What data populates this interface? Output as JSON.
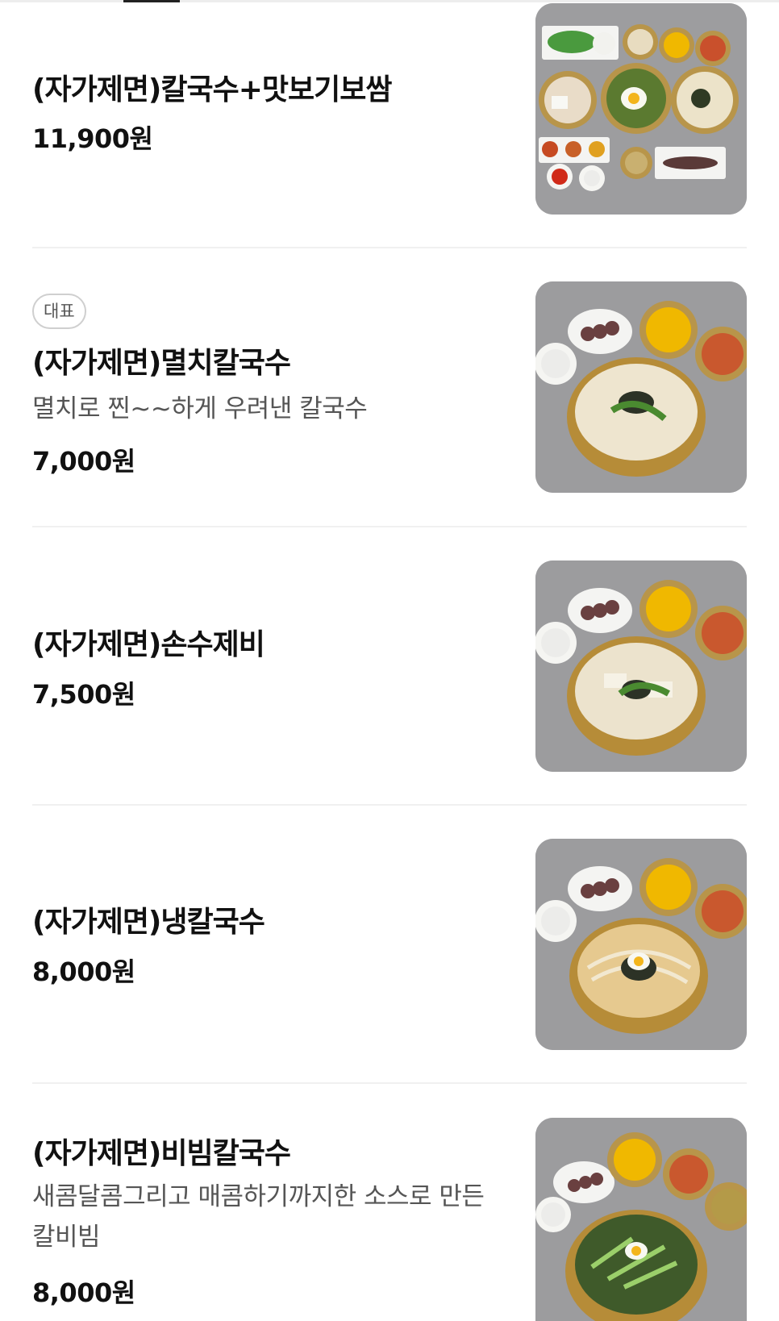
{
  "menu": {
    "items": [
      {
        "name": "(자가제면)칼국수+맛보기보쌈",
        "badge": "",
        "description": "",
        "price": "11,900원",
        "image_icon": "kalguksu-bossam-set-photo"
      },
      {
        "name": "(자가제면)멸치칼국수",
        "badge": "대표",
        "description": "멸치로 찐~~하게 우려낸 칼국수",
        "price": "7,000원",
        "image_icon": "anchovy-kalguksu-photo"
      },
      {
        "name": "(자가제면)손수제비",
        "badge": "",
        "description": "",
        "price": "7,500원",
        "image_icon": "sujebi-photo"
      },
      {
        "name": "(자가제면)냉칼국수",
        "badge": "",
        "description": "",
        "price": "8,000원",
        "image_icon": "cold-kalguksu-photo"
      },
      {
        "name": "(자가제면)비빔칼국수",
        "badge": "",
        "description": "새콤달콤그리고 매콤하기까지한 소스로 만든 칼비빔",
        "price": "8,000원",
        "image_icon": "bibim-kalguksu-photo"
      }
    ]
  },
  "colors": {
    "background": "#ffffff",
    "text": "#111111",
    "muted": "#555555",
    "divider": "#f0f0f0",
    "photo_bg": "#9a9a9c",
    "brass": "#c9a54a"
  }
}
